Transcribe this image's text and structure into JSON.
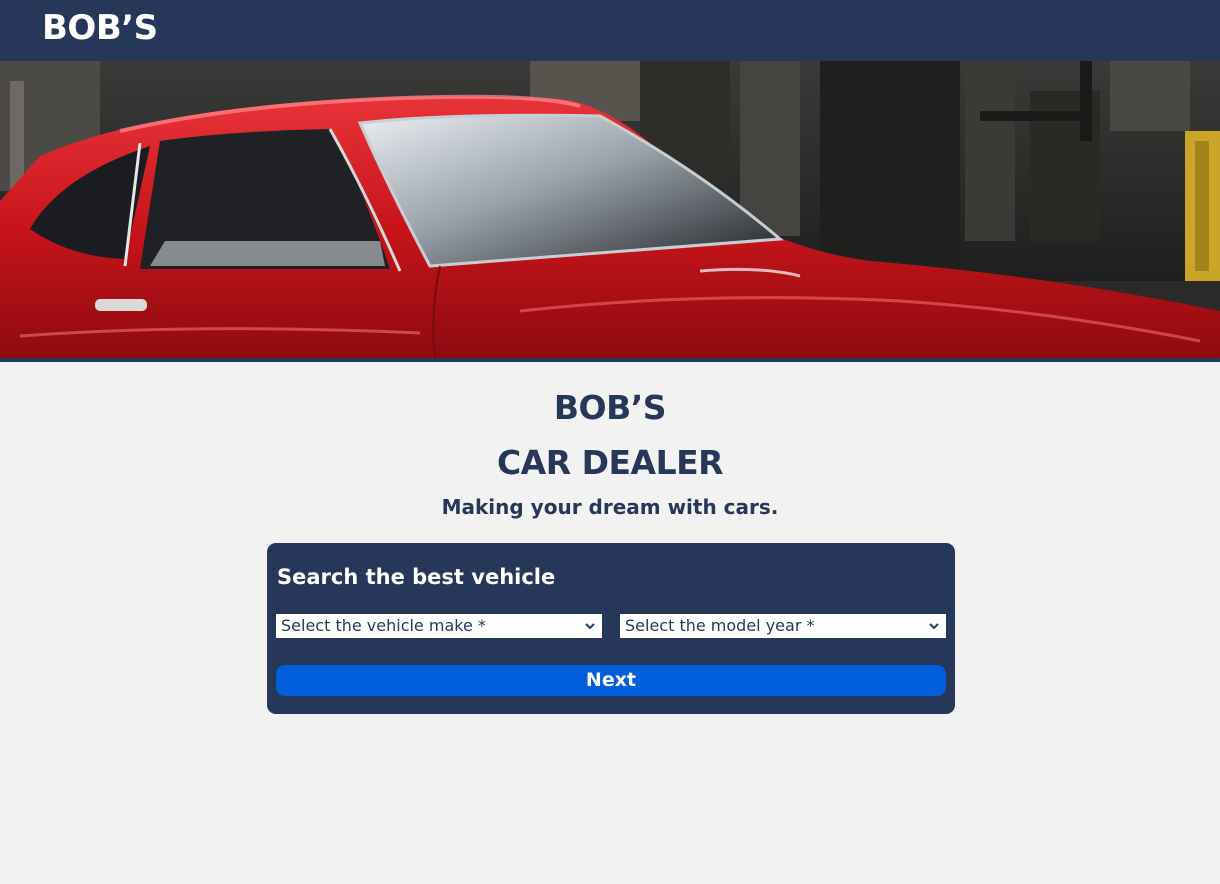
{
  "header": {
    "brand": "BOB’S"
  },
  "hero": {
    "image": "red-classic-sports-car-photo"
  },
  "main": {
    "title_line1": "BOB’S",
    "title_line2": "CAR DEALER",
    "tagline": "Making your dream with cars."
  },
  "search": {
    "heading": "Search the best vehicle",
    "make_select": "Select the vehicle make *",
    "year_select": "Select the model year *",
    "next_label": "Next"
  },
  "colors": {
    "navy": "#273759",
    "button_blue": "#025fdb",
    "background": "#f2f2f2",
    "car_red": "#d01a1f"
  }
}
